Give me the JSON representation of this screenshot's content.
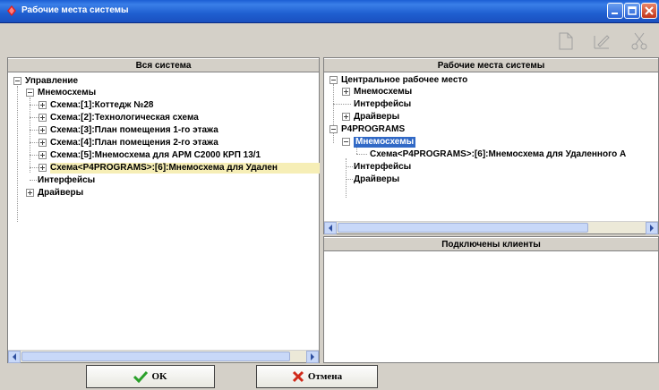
{
  "window": {
    "title": "Рабочие места системы"
  },
  "left_panel": {
    "header": "Вся система",
    "tree": {
      "root": "Управление",
      "mnemo": "Мнемосхемы",
      "schemes": [
        "Схема:[1]:Коттедж №28",
        "Схема:[2]:Технологическая схема",
        "Схема:[3]:План помещения 1-го этажа",
        "Схема:[4]:План помещения 2-го этажа",
        "Схема:[5]:Мнемосхема для АРМ С2000 КРП 13/1",
        "Схема<P4PROGRAMS>:[6]:Мнемосхема для Удален"
      ],
      "interfaces": "Интерфейсы",
      "drivers": "Драйверы"
    }
  },
  "right_panel": {
    "header": "Рабочие места системы",
    "tree": {
      "central": "Центральное рабочее место",
      "central_mnemo": "Мнемосхемы",
      "central_interfaces": "Интерфейсы",
      "central_drivers": "Драйверы",
      "p4": "P4PROGRAMS",
      "p4_mnemo": "Мнемосхемы",
      "p4_scheme": "Схема<P4PROGRAMS>:[6]:Мнемосхема для Удаленного А",
      "p4_interfaces": "Интерфейсы",
      "p4_drivers": "Драйверы"
    }
  },
  "clients_panel": {
    "header": "Подключены клиенты"
  },
  "buttons": {
    "ok": "OK",
    "cancel": "Отмена"
  },
  "colors": {
    "titlebar": "#1f5fd0",
    "selection": "#3169c6",
    "ok_check": "#2aa02a",
    "cancel_x": "#d02a1a"
  }
}
